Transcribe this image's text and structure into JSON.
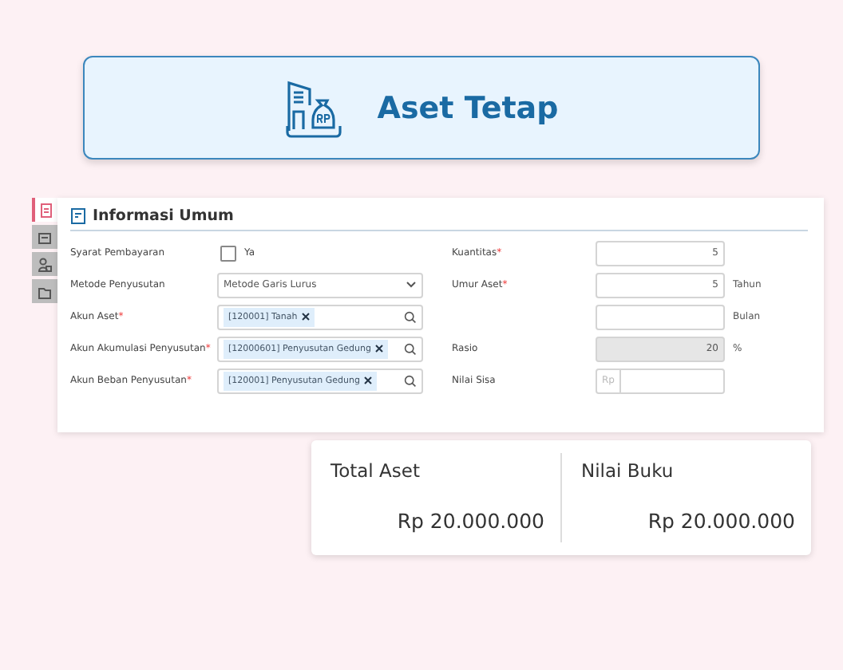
{
  "header": {
    "title": "Aset Tetap"
  },
  "side_tabs": [
    {
      "selected": true
    },
    {
      "selected": false
    },
    {
      "selected": false
    },
    {
      "selected": false
    }
  ],
  "section": {
    "title": "Informasi Umum"
  },
  "left_fields": [
    {
      "kind": "checkbox",
      "label": "Syarat Pembayaran",
      "checked": false,
      "option": "Ya"
    },
    {
      "kind": "select",
      "label": "Metode Penyusutan",
      "value": "Metode Garis Lurus"
    },
    {
      "kind": "lookup",
      "label": "Akun Aset",
      "required_mark": "*",
      "tag": "[120001] Tanah"
    },
    {
      "kind": "lookup",
      "label": "Akun Akumulasi Penyusutan",
      "required_mark": "*",
      "tag": "[12000601] Penyusutan Gedung"
    },
    {
      "kind": "lookup",
      "label": "Akun Beban Penyusutan",
      "required_mark": "*",
      "tag": "[120001] Penyusutan Gedung"
    }
  ],
  "right_fields": [
    {
      "kind": "number",
      "label": "Kuantitas",
      "required_mark": "*",
      "value": "5",
      "disabled": false
    },
    {
      "kind": "number",
      "label": "Umur Aset",
      "required_mark": "*",
      "value": "5",
      "unit": "Tahun",
      "disabled": false
    },
    {
      "kind": "number",
      "unit": "Bulan",
      "disabled": false
    },
    {
      "kind": "number",
      "label": "Rasio",
      "value": "20",
      "unit": "%",
      "disabled": true
    },
    {
      "kind": "currency",
      "label": "Nilai Sisa",
      "prefix": "Rp",
      "disabled": false
    }
  ],
  "summary": [
    {
      "label": "Total Aset",
      "value": "Rp 20.000.000"
    },
    {
      "label": "Nilai Buku",
      "value": "Rp 20.000.000"
    }
  ]
}
